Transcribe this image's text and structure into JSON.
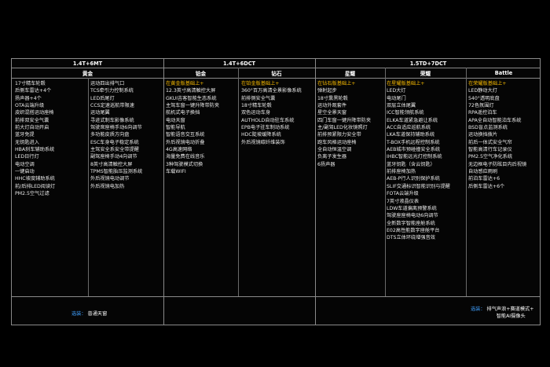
{
  "engine_groups": [
    "1.4T+6MT",
    "1.4T+6DCT",
    "1.5TD+7DCT"
  ],
  "trims": [
    "黄金",
    "铂金",
    "钻石",
    "星耀",
    "荣耀",
    "Battle"
  ],
  "columns": {
    "huangjin_a": [
      "17寸精车轮毂",
      "后侧车雷达+4个",
      "扬声器+4个",
      "OTA云端升级",
      "皮织混搭运动座椅",
      "前排双安全气囊",
      "前大灯自动开启",
      "蓝牙免提",
      "无钥匙进入",
      "HBA刹车辅助系统",
      "LED日行灯",
      "电动空调",
      "一键启动",
      "HHC坡度辅助系统",
      "前/后排LED阅读灯",
      "PM2.5空气过滤"
    ],
    "huangjin_b": [
      "运动四出排气口",
      "TCS牵引力控制系统",
      "LED后尾灯",
      "CCS定速巡航带限速",
      "运动尾翼",
      "寻迹式制车影像系统",
      "驾驶席座椅手动6向调节",
      "多功能皮质方向盘",
      "ESC车身电子稳定系统",
      "主驾安全系安全带提醒",
      "副驾座椅手动4向调节",
      "8英寸高清触控大屏",
      "TPMS智能胎压监测系统",
      "外后视镜电动调节",
      "外后视镜电加热"
    ],
    "bojin": [
      "在黄金版基础上+",
      "12.3英寸高清触控大屏",
      "GKUI吉客智能生态系统",
      "主驾车窗一键升降带防夹",
      "航机式电子换挡",
      "电动天窗",
      "智能导航",
      "智能语音交互系统",
      "外后视镜电动折叠",
      "4G高速网络",
      "海量免费在线音乐",
      "3种驾驶模式切换",
      "车载WIFI"
    ],
    "zuanshi": [
      "在铂金版基础上+",
      "360°百万高清全景影像系统",
      "前排侧安全气囊",
      "18寸精车轮毂",
      "双色运动车身",
      "AUTHOLD自动驻车系统",
      "EPB电子驻车制动系统",
      "HDC陡坡缓降系统",
      "外后视镜碳纤维装饰"
    ],
    "xingyao": [
      "在钻石版基础上+",
      "弹射起步",
      "18寸熏黑轮毂",
      "运动外观套件",
      "星空全景天窗",
      "四门车窗一键升降带防夹",
      "主/副驾LED化妆镜照灯",
      "前排预紧限力安全带",
      "跑车风格运动座椅",
      "全自动恒温空调",
      "负离子发生器",
      "6扬声器"
    ],
    "rongyao": [
      "在星耀版基础上+",
      "LED大灯",
      "电动尾门",
      "双层立体尾翼",
      "ICC智能领航系统",
      "ELKA车道紧急避让系统",
      "ACC自适应巡航系统",
      "LKA车道保持辅助系统",
      "T-BOX手机远程控制系统",
      "AEB城市预碰撞安全系统",
      "IHBC智能远光灯控制系统",
      "蓝牙钥匙（含云钥匙）",
      "前排座椅加热",
      "AEB-P行人识别保护系统",
      "SLIF交通标识智能识别与提醒",
      "FOTA云端升级",
      "7英寸液晶仪表",
      "LDW车道偏离预警系统",
      "驾驶座座椅电动6向调节",
      "全新数字智能座舱系统",
      "E02高性能数字座舱平台",
      "DTS立体环绕增强音效"
    ],
    "battle": [
      "在荣耀版基础上+",
      "LED静动大灯",
      "540°透明底盘",
      "72色氛围灯",
      "RPA遥控泊车",
      "APA全自动智能泊车系统",
      "BSD盲点监测系统",
      "运动换挡拨片",
      "前后一体式安全气帘",
      "智能高清行车记录仪",
      "PM2.5空气净化系统",
      "无边框电子防眩目内后视镜",
      "自动感应雨刷",
      "前泊车雷达+6",
      "后侧车雷达+6个"
    ]
  },
  "options": {
    "left": {
      "label": "选装：",
      "value": "普通天窗"
    },
    "right": {
      "label": "选装：",
      "value": "排气声浪+赛道模式+",
      "value2": "智能AI摄像头"
    }
  },
  "colors": {
    "background": "#000000",
    "highlight": "#f5b800",
    "option_label": "#3fa0ff",
    "grid": "#8a8a8a"
  }
}
